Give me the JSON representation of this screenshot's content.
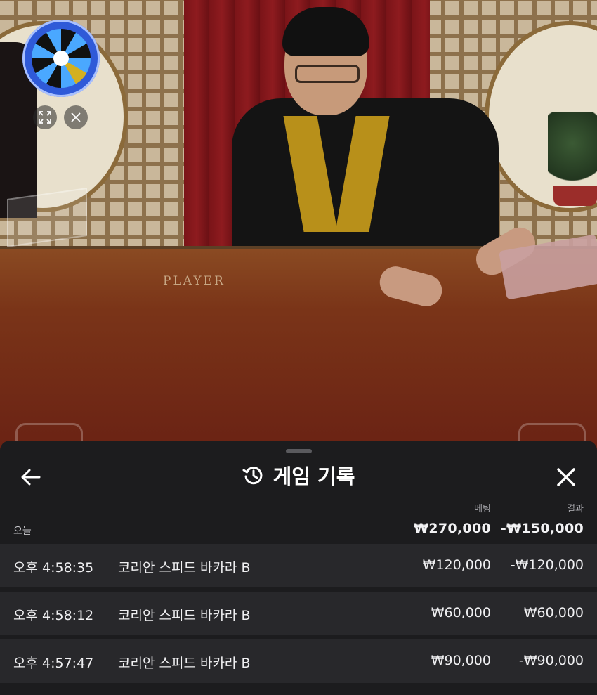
{
  "video": {
    "table_text": "PLAYER"
  },
  "header": {
    "title": "게임 기록",
    "history_icon": "history-icon",
    "back_icon": "arrow-left-icon",
    "close_icon": "close-icon"
  },
  "columns": {
    "bet": "베팅",
    "result": "결과"
  },
  "summary": {
    "label": "오늘",
    "bet_total": "₩270,000",
    "result_total": "-₩150,000"
  },
  "rows": [
    {
      "time": "오후 4:58:35",
      "game": "코리안 스피드 바카라 B",
      "bet": "₩120,000",
      "result": "-₩120,000"
    },
    {
      "time": "오후 4:58:12",
      "game": "코리안 스피드 바카라 B",
      "bet": "₩60,000",
      "result": "₩60,000"
    },
    {
      "time": "오후 4:57:47",
      "game": "코리안 스피드 바카라 B",
      "bet": "₩90,000",
      "result": "-₩90,000"
    }
  ],
  "colors": {
    "sheet_bg": "#1c1c1e",
    "row_bg": "#28282b",
    "text": "#ffffff",
    "muted": "#a3a3a8"
  }
}
